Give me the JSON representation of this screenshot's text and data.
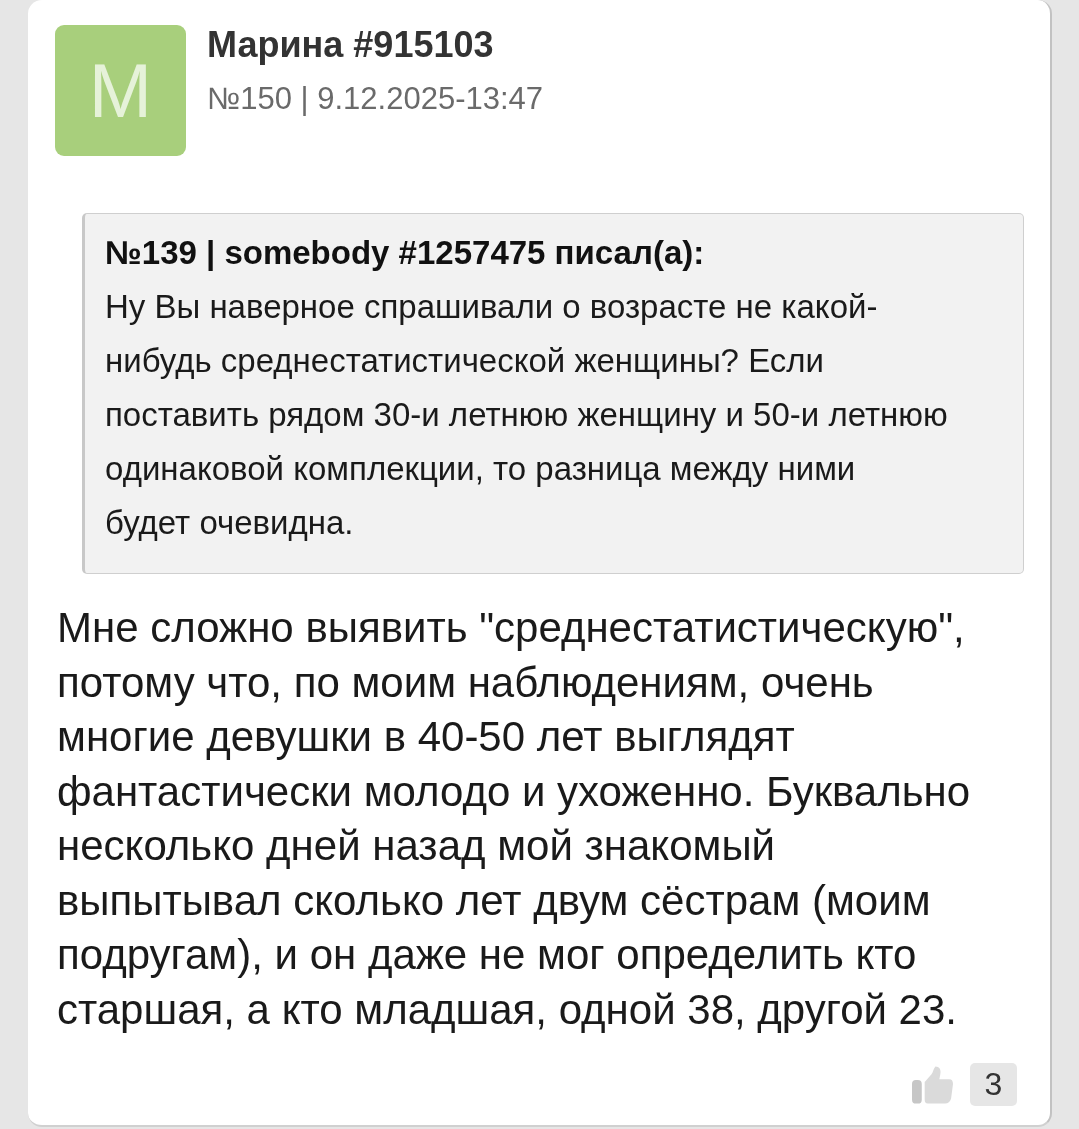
{
  "post": {
    "avatar": {
      "letter": "M"
    },
    "author": "Марина #915103",
    "meta": "№150 | 9.12.2025-13:47"
  },
  "quote": {
    "header": "№139 | somebody #1257475 писал(а):",
    "text": "Ну Вы наверное спрашивали о возрасте не какой-\nнибудь среднестатистической женщины? Если\nпоставить рядом 30-и летнюю женщину и 50-и летнюю\nодинаковой комплекции, то разница между ними\nбудет очевидна."
  },
  "body": "Мне сложно выявить \"среднестатистическую\",\nпотому что, по моим наблюдениям, очень\nмногие девушки в 40-50 лет выглядят\nфантастически молодо и ухоженно. Буквально\nнесколько дней назад мой знакомый\nвыпытывал сколько лет двум сёстрам (моим\nподругам), и он даже не мог определить кто\nстаршая, а кто младшая, одной 38, другой 23.",
  "likes": {
    "count": "3"
  }
}
